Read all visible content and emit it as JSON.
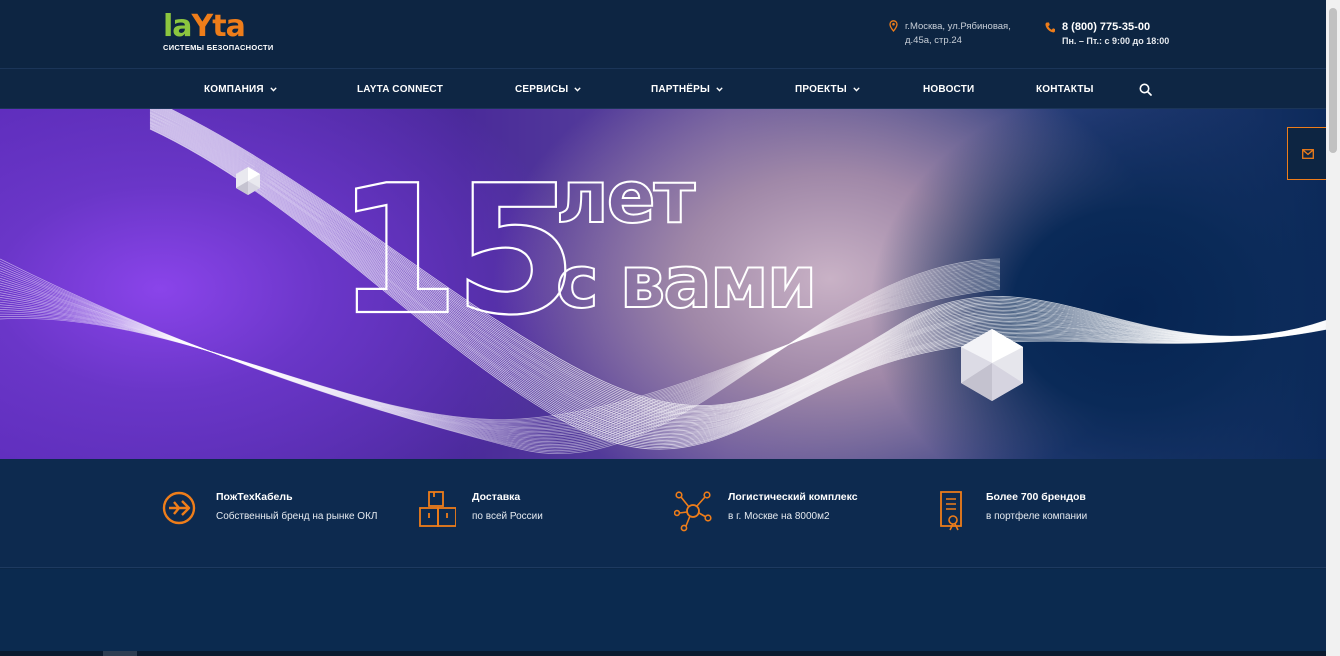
{
  "header": {
    "logo_word_l": "la",
    "logo_word_rest": "Yta",
    "logo_subtitle": "СИСТЕМЫ БЕЗОПАСНОСТИ",
    "address_line1": "г.Москва, ул.Рябиновая,",
    "address_line2": "д.45а, стр.24",
    "phone": "8 (800) 775-35-00",
    "hours": "Пн. – Пт.: с 9:00 до 18:00"
  },
  "nav": {
    "items": [
      {
        "label": "КОМПАНИЯ",
        "dropdown": true
      },
      {
        "label": "LAYTA CONNECT",
        "dropdown": false
      },
      {
        "label": "СЕРВИСЫ",
        "dropdown": true
      },
      {
        "label": "ПАРТНЁРЫ",
        "dropdown": true
      },
      {
        "label": "ПРОЕКТЫ",
        "dropdown": true
      },
      {
        "label": "НОВОСТИ",
        "dropdown": false
      },
      {
        "label": "КОНТАКТЫ",
        "dropdown": false
      }
    ],
    "search_icon": "search-icon"
  },
  "hero": {
    "number": "15",
    "line1": "лет",
    "line2": "с вами"
  },
  "features": [
    {
      "title": "ПожТехКабель",
      "subtitle": "Собственный бренд на рынке ОКЛ",
      "icon": "brand-arrow-icon"
    },
    {
      "title": "Доставка",
      "subtitle": "по всей России",
      "icon": "boxes-icon"
    },
    {
      "title": "Логистический комплекс",
      "subtitle": "в г. Москве на 8000м2",
      "icon": "network-hub-icon"
    },
    {
      "title": "Более 700 брендов",
      "subtitle": "в портфеле компании",
      "icon": "document-icon"
    }
  ],
  "colors": {
    "accent": "#ee7d1a",
    "logo_green": "#8cc63f",
    "header_bg": "#0d2542",
    "features_bg": "#0d2a4f"
  }
}
